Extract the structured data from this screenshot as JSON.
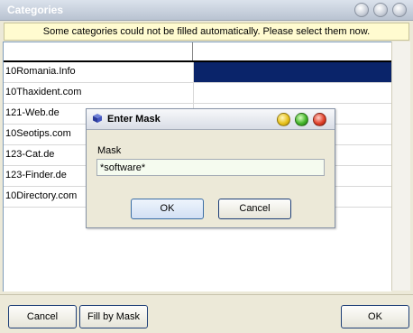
{
  "window": {
    "title": "Categories"
  },
  "notice": "Some categories could not be filled automatically. Please select them now.",
  "grid": {
    "rows": [
      {
        "name": "10Romania.Info",
        "selected": true
      },
      {
        "name": "10Thaxident.com",
        "selected": false
      },
      {
        "name": "121-Web.de",
        "selected": false
      },
      {
        "name": "10Seotips.com",
        "selected": false
      },
      {
        "name": "123-Cat.de",
        "selected": false
      },
      {
        "name": "123-Finder.de",
        "selected": false
      },
      {
        "name": "10Directory.com",
        "selected": false
      }
    ]
  },
  "footer": {
    "cancel": "Cancel",
    "fill_by_mask": "Fill by Mask",
    "ok": "OK"
  },
  "dialog": {
    "title": "Enter Mask",
    "label": "Mask",
    "value": "*software*",
    "ok": "OK",
    "cancel": "Cancel",
    "title_buttons": [
      "yellow-minimize",
      "green-maximize",
      "red-close"
    ]
  },
  "colors": {
    "selection": "#0a246a",
    "notice_bg": "#fffbd0",
    "window_bg": "#ece9d8"
  }
}
